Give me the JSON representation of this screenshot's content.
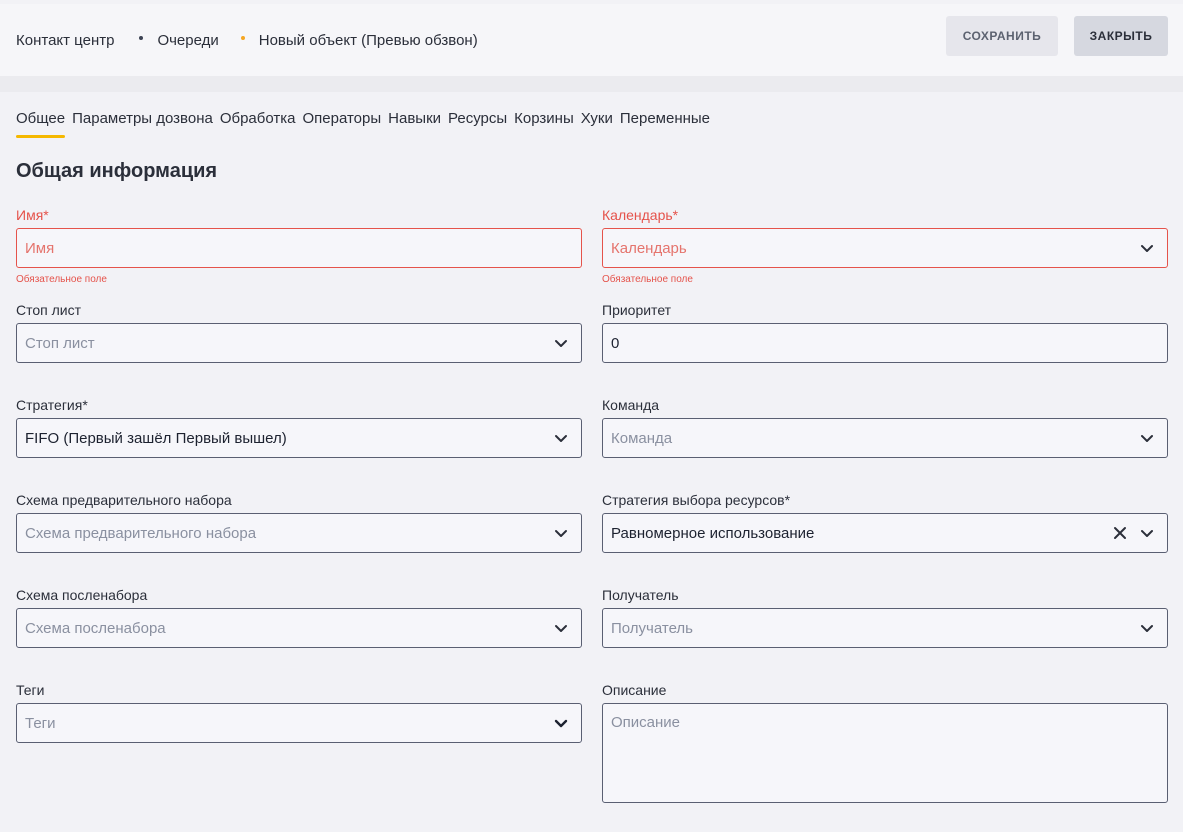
{
  "breadcrumb": {
    "items": [
      "Контакт центр",
      "Очереди",
      "Новый объект (Превью обзвон)"
    ]
  },
  "toolbar": {
    "save_label": "СОХРАНИТЬ",
    "close_label": "ЗАКРЫТЬ"
  },
  "tabs": [
    {
      "label": "Общее",
      "active": true
    },
    {
      "label": "Параметры дозвона"
    },
    {
      "label": "Обработка"
    },
    {
      "label": "Операторы"
    },
    {
      "label": "Навыки"
    },
    {
      "label": "Ресурсы"
    },
    {
      "label": "Корзины"
    },
    {
      "label": "Хуки"
    },
    {
      "label": "Переменные"
    }
  ],
  "section_title": "Общая информация",
  "fields": {
    "name": {
      "label": "Имя*",
      "placeholder": "Имя",
      "hint": "Обязательное поле"
    },
    "calendar": {
      "label": "Календарь*",
      "placeholder": "Календарь",
      "hint": "Обязательное поле"
    },
    "stoplist": {
      "label": "Стоп лист",
      "placeholder": "Стоп лист"
    },
    "priority": {
      "label": "Приоритет",
      "value": "0"
    },
    "strategy": {
      "label": "Стратегия*",
      "value": "FIFO (Первый зашёл Первый вышел)"
    },
    "team": {
      "label": "Команда",
      "placeholder": "Команда"
    },
    "predial": {
      "label": "Схема предварительного набора",
      "placeholder": "Схема предварительного набора"
    },
    "resource_strategy": {
      "label": "Стратегия выбора ресурсов*",
      "value": "Равномерное использование"
    },
    "postdial": {
      "label": "Схема посленабора",
      "placeholder": "Схема посленабора"
    },
    "recipient": {
      "label": "Получатель",
      "placeholder": "Получатель"
    },
    "tags": {
      "label": "Теги",
      "placeholder": "Теги"
    },
    "description": {
      "label": "Описание",
      "placeholder": "Описание"
    }
  },
  "colors": {
    "accent": "#f5b800",
    "error": "#e5534b",
    "breadcrumb_active_dot": "#f5a623"
  }
}
